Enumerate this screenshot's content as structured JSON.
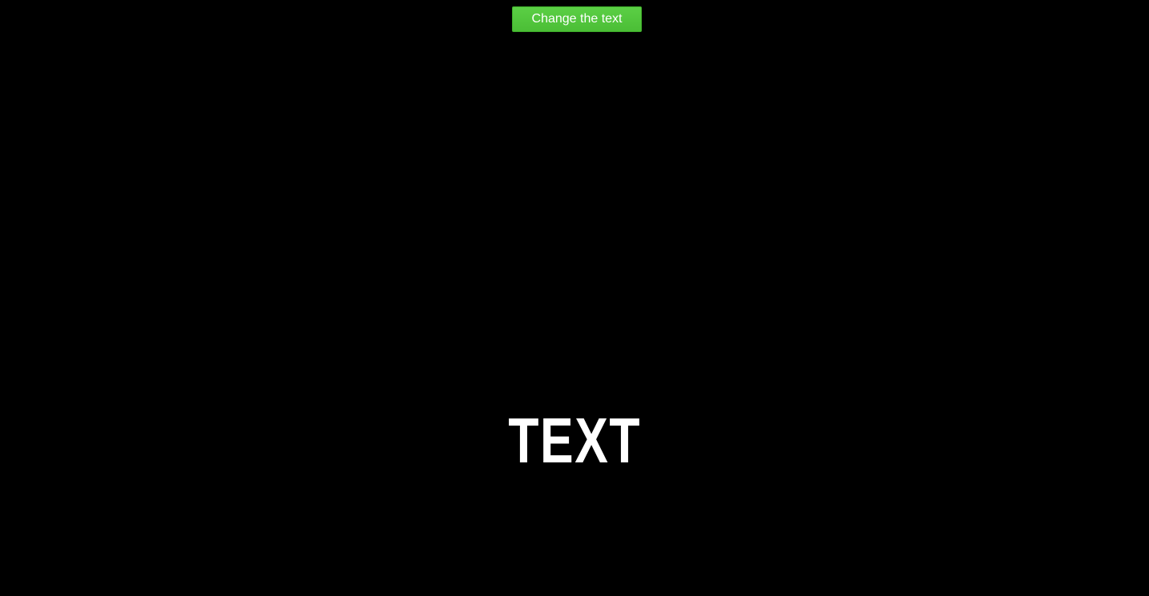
{
  "toolbar": {
    "change_text_button_label": "Change the text"
  },
  "main": {
    "display_text": "TEXT"
  },
  "colors": {
    "background": "#000000",
    "button": "#4fc43a",
    "text": "#ffffff"
  }
}
